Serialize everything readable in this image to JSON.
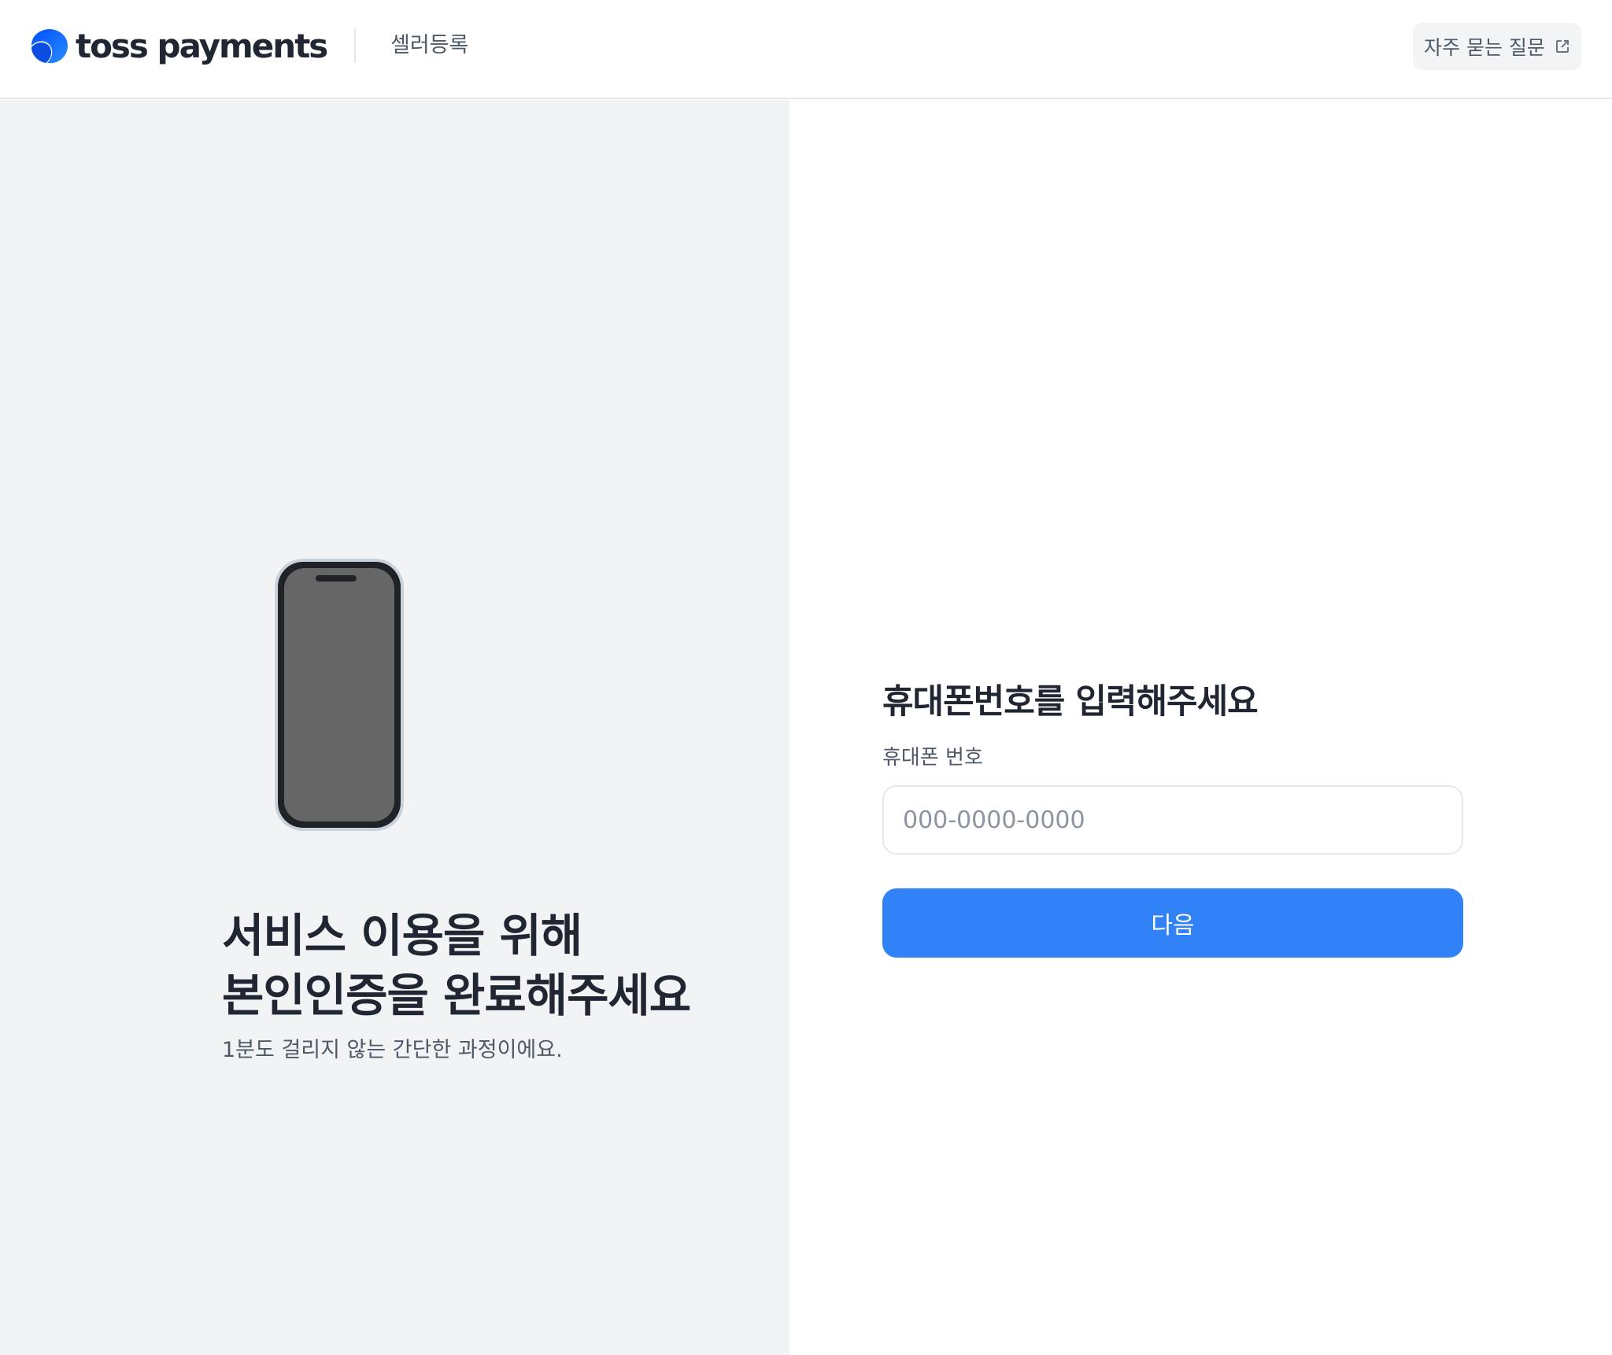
{
  "header": {
    "logo_text": "toss payments",
    "subtitle": "셀러등록",
    "faq_label": "자주 묻는 질문"
  },
  "left": {
    "title_line1": "서비스 이용을 위해",
    "title_line2": "본인인증을 완료해주세요",
    "description": "1분도 걸리지 않는 간단한 과정이에요."
  },
  "form": {
    "title": "휴대폰번호를 입력해주세요",
    "phone_label": "휴대폰 번호",
    "phone_value": "",
    "phone_placeholder": "000-0000-0000",
    "next_label": "다음"
  },
  "colors": {
    "accent": "#3182f6",
    "left_background": "#f2f3f5",
    "text_primary": "#202632",
    "text_secondary": "#4e5968"
  },
  "icons": {
    "logo": "toss-logo-icon",
    "faq": "external-link-icon",
    "illustration": "smartphone-icon"
  }
}
